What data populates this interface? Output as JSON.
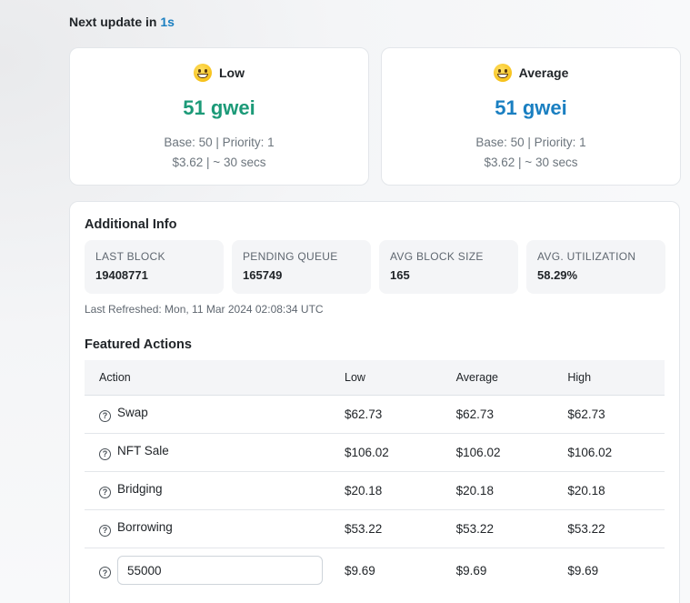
{
  "header": {
    "next_update_label": "Next update in",
    "next_update_value": "1s"
  },
  "gas_cards": [
    {
      "label": "Low",
      "price": "51 gwei",
      "base_priority": "Base: 50 | Priority: 1",
      "cost_time": "$3.62 | ~ 30 secs",
      "icon": "grinning-face-icon",
      "color": "#1c9a78"
    },
    {
      "label": "Average",
      "price": "51 gwei",
      "base_priority": "Base: 50 | Priority: 1",
      "cost_time": "$3.62 | ~ 30 secs",
      "icon": "smiling-face-icon",
      "color": "#1a7fc1"
    }
  ],
  "additional_info": {
    "title": "Additional Info",
    "stats": [
      {
        "label": "LAST BLOCK",
        "value": "19408771"
      },
      {
        "label": "PENDING QUEUE",
        "value": "165749"
      },
      {
        "label": "AVG BLOCK SIZE",
        "value": "165"
      },
      {
        "label": "AVG. UTILIZATION",
        "value": "58.29%"
      }
    ],
    "last_refreshed": "Last Refreshed: Mon, 11 Mar 2024 02:08:34 UTC"
  },
  "featured_actions": {
    "title": "Featured Actions",
    "columns": [
      "Action",
      "Low",
      "Average",
      "High"
    ],
    "rows": [
      {
        "action": "Swap",
        "low": "$62.73",
        "average": "$62.73",
        "high": "$62.73"
      },
      {
        "action": "NFT Sale",
        "low": "$106.02",
        "average": "$106.02",
        "high": "$106.02"
      },
      {
        "action": "Bridging",
        "low": "$20.18",
        "average": "$20.18",
        "high": "$20.18"
      },
      {
        "action": "Borrowing",
        "low": "$53.22",
        "average": "$53.22",
        "high": "$53.22"
      }
    ],
    "custom_row": {
      "input_value": "55000",
      "low": "$9.69",
      "average": "$9.69",
      "high": "$9.69"
    }
  }
}
